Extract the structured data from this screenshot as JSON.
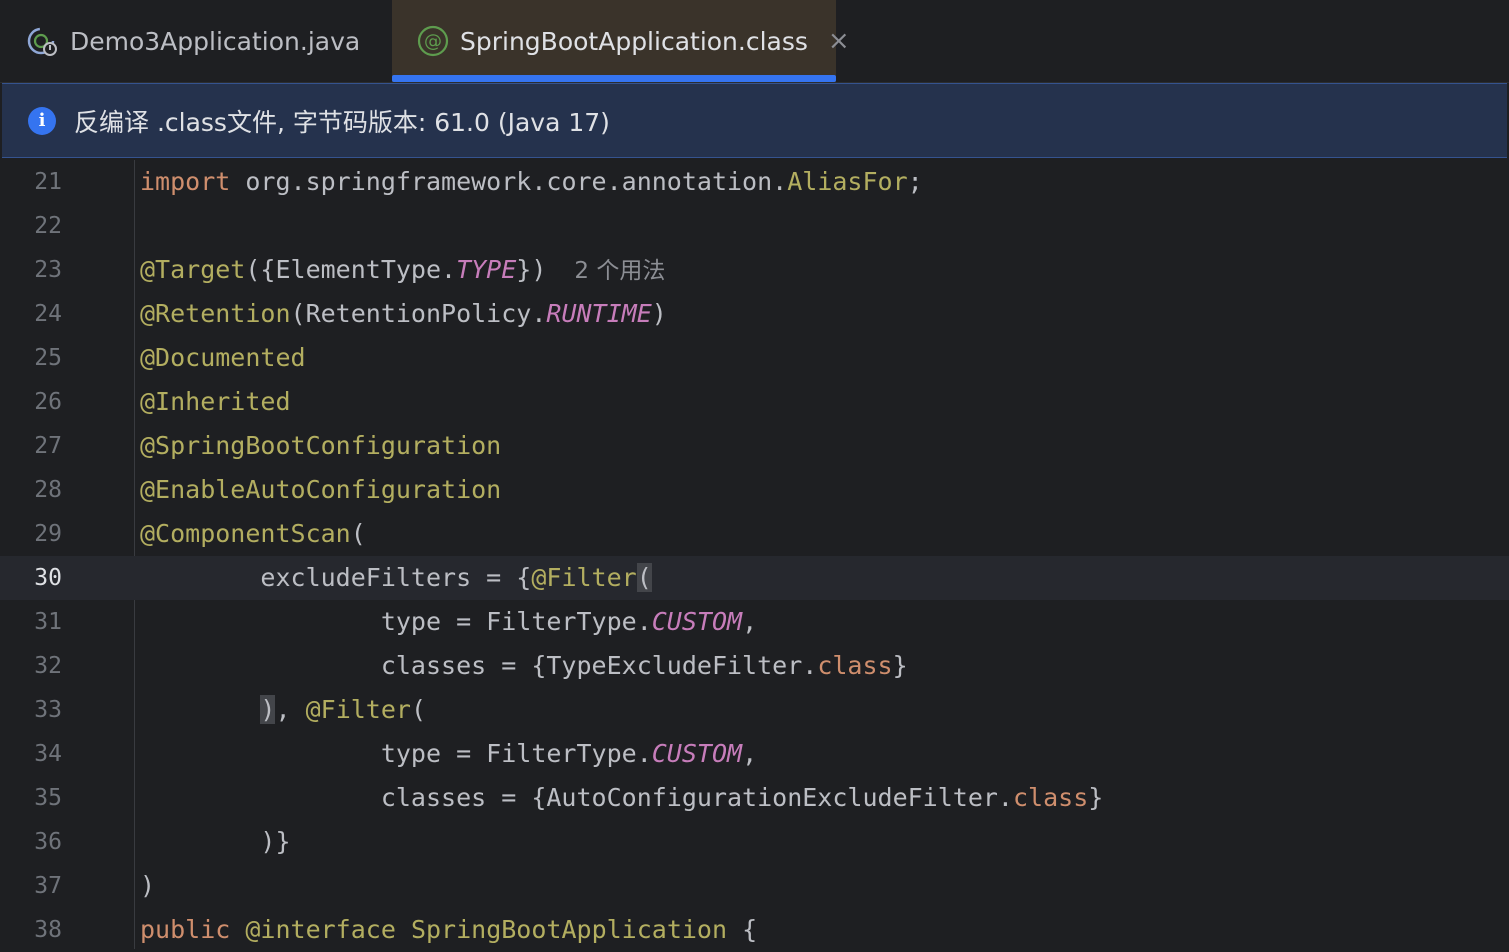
{
  "tabs": [
    {
      "label": "Demo3Application.java",
      "icon": "spring-run-icon",
      "active": false
    },
    {
      "label": "SpringBootApplication.class",
      "icon": "annotation-icon",
      "active": true,
      "close": "×"
    }
  ],
  "banner": {
    "icon": "info-icon",
    "icon_glyph": "i",
    "text": "反编译 .class文件, 字节码版本: 61.0 (Java 17)"
  },
  "editor": {
    "current_line": "30",
    "usage_hint": "2 个用法",
    "lines": [
      {
        "n": "21"
      },
      {
        "n": "22"
      },
      {
        "n": "23"
      },
      {
        "n": "24"
      },
      {
        "n": "25"
      },
      {
        "n": "26"
      },
      {
        "n": "27"
      },
      {
        "n": "28"
      },
      {
        "n": "29"
      },
      {
        "n": "30"
      },
      {
        "n": "31"
      },
      {
        "n": "32"
      },
      {
        "n": "33"
      },
      {
        "n": "34"
      },
      {
        "n": "35"
      },
      {
        "n": "36"
      },
      {
        "n": "37"
      },
      {
        "n": "38"
      }
    ]
  },
  "colors": {
    "background": "#1e1f22",
    "keyword": "#cf8e6d",
    "annotation": "#b3ae60",
    "enum_constant": "#c77dbb",
    "accent": "#3574f0",
    "banner": "#25324d"
  }
}
